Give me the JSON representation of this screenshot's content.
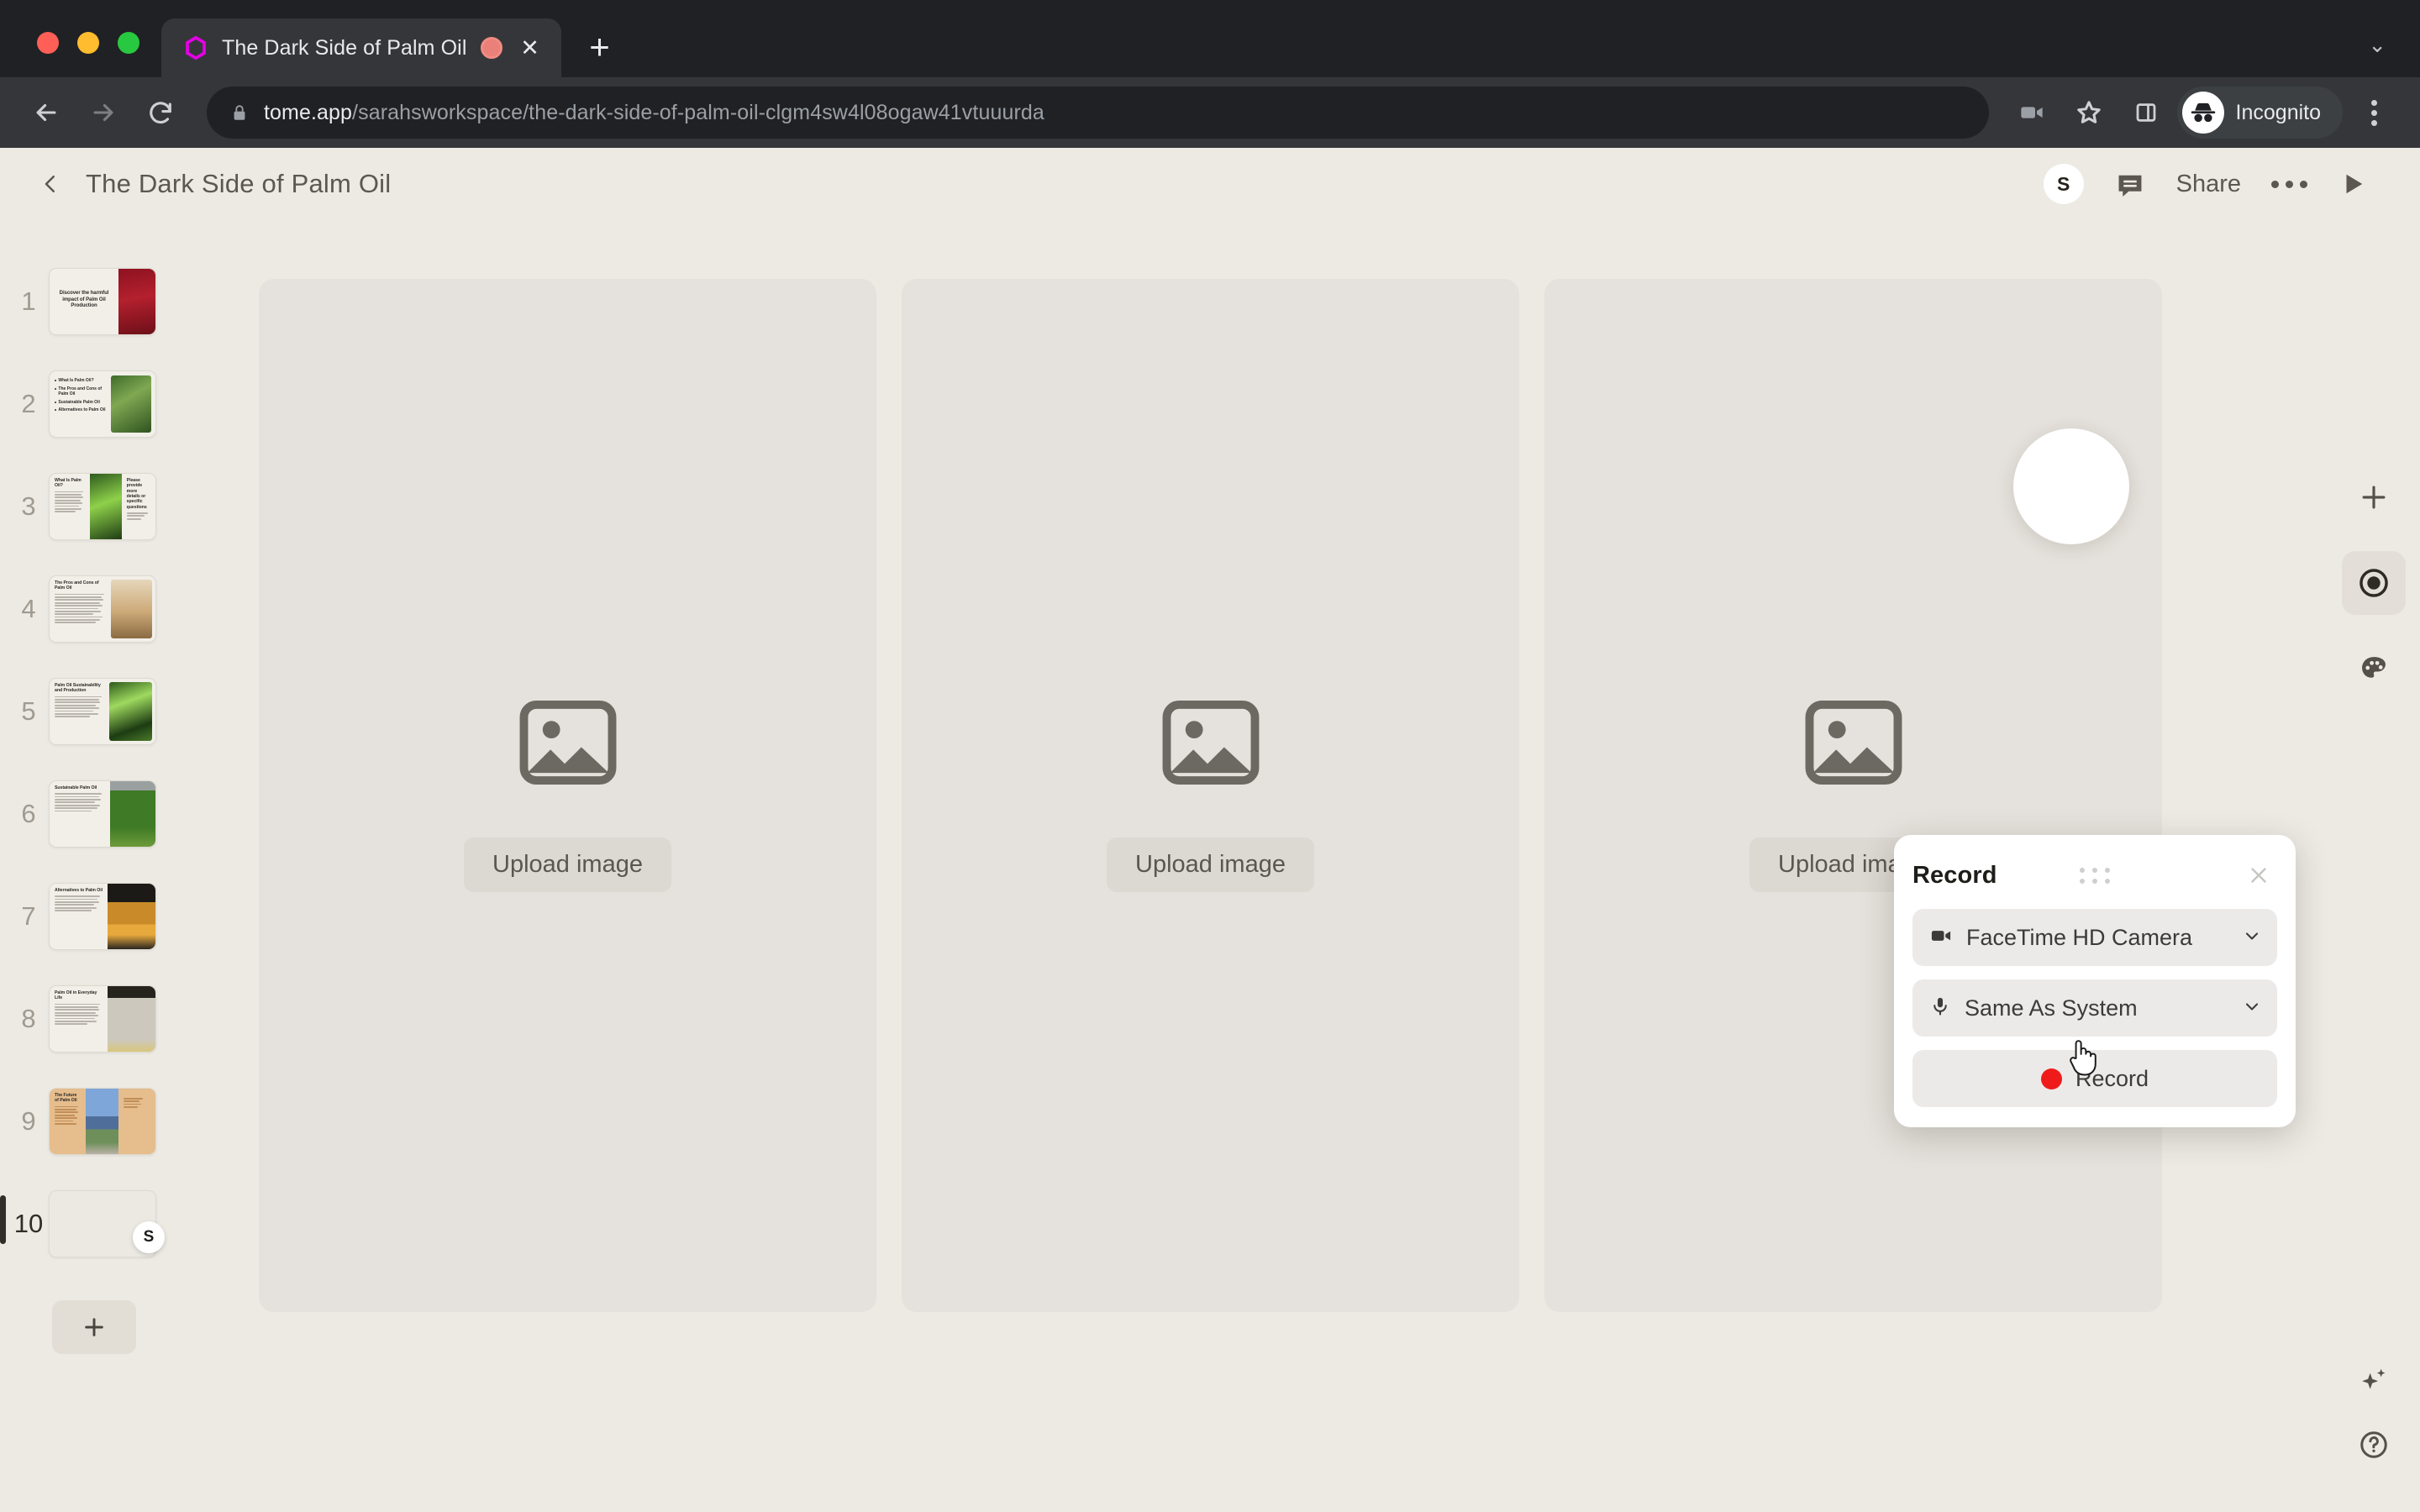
{
  "browser": {
    "tab": {
      "title": "The Dark Side of Palm Oil",
      "favicon_name": "tome-hexagon-icon",
      "recording_indicator_name": "tab-recording-indicator",
      "close_label": "✕"
    },
    "new_tab_label": "+",
    "tab_list_chevron": "⌄",
    "url_host": "tome.app",
    "url_path": "/sarahsworkspace/the-dark-side-of-palm-oil-clgm4sw4l08ogaw41vtuuurda",
    "profile_label": "Incognito",
    "colors": {
      "chrome_bg": "#202124",
      "toolbar_bg": "#35363a",
      "favicon_accent": "#e600e6"
    }
  },
  "app": {
    "header": {
      "title": "The Dark Side of Palm Oil",
      "avatar_initial": "S",
      "share_label": "Share",
      "back_icon": "chevron-left-icon",
      "comment_icon": "comment-icon",
      "more_icon": "more-horizontal-icon",
      "play_icon": "play-icon"
    },
    "sidebar": {
      "slides": [
        {
          "number": "1",
          "title": "Discover the harmful impact of Palm Oil Production",
          "style": "title-red",
          "selected": false
        },
        {
          "number": "2",
          "title": "",
          "style": "toc-green",
          "selected": false,
          "bullets": [
            "What Is Palm Oil?",
            "The Pros and Cons of Palm Oil",
            "Sustainable Palm Oil",
            "Alternatives to Palm Oil"
          ]
        },
        {
          "number": "3",
          "title": "What Is Palm Oil?",
          "style": "three-col-green",
          "selected": false
        },
        {
          "number": "4",
          "title": "The Pros and Cons of Palm Oil",
          "style": "text-desert",
          "selected": false
        },
        {
          "number": "5",
          "title": "Palm Oil Sustainability and Production",
          "style": "text-jungle",
          "selected": false
        },
        {
          "number": "6",
          "title": "Sustainable Palm Oil",
          "style": "text-plantation",
          "selected": false
        },
        {
          "number": "7",
          "title": "Alternatives to Palm Oil",
          "style": "text-bottles",
          "selected": false
        },
        {
          "number": "8",
          "title": "Palm Oil in Everyday Life",
          "style": "text-products",
          "selected": false
        },
        {
          "number": "9",
          "title": "The Future of Palm Oil",
          "style": "text-city-tan",
          "selected": false
        },
        {
          "number": "10",
          "title": "",
          "style": "blank",
          "selected": true,
          "avatar_initial": "S"
        }
      ],
      "add_slide_label": "+"
    },
    "canvas": {
      "cards": [
        {
          "upload_label": "Upload image",
          "placeholder_icon": "image-placeholder-icon"
        },
        {
          "upload_label": "Upload image",
          "placeholder_icon": "image-placeholder-icon"
        },
        {
          "upload_label": "Upload image",
          "placeholder_icon": "image-placeholder-icon"
        }
      ],
      "camera_bubble_name": "camera-preview-bubble"
    },
    "rail": {
      "add_icon": "plus-icon",
      "record_icon": "record-target-icon",
      "theme_icon": "palette-icon",
      "ai_icon": "sparkle-icon",
      "help_icon": "help-circle-icon"
    },
    "record_panel": {
      "title": "Record",
      "drag_handle_name": "drag-handle",
      "close_label": "✕",
      "camera_value": "FaceTime HD Camera",
      "microphone_value": "Same As System",
      "record_button_label": "Record",
      "record_dot_color": "#ef1b1b"
    }
  }
}
